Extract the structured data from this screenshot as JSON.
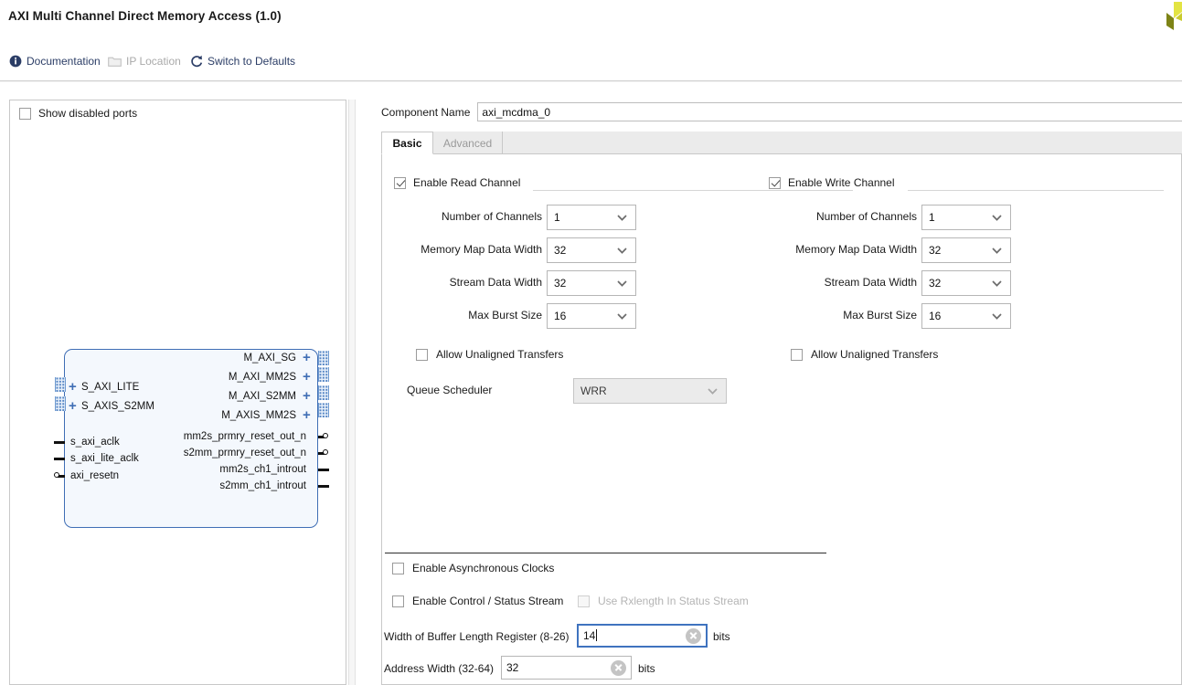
{
  "window": {
    "title": "AXI Multi Channel Direct Memory Access (1.0)",
    "logo_name": "amd-xilinx-logo"
  },
  "toolbar": {
    "links": [
      {
        "label": "Documentation",
        "icon": "info-icon",
        "enabled": true
      },
      {
        "label": "IP Location",
        "icon": "folder-icon",
        "enabled": false
      },
      {
        "label": "Switch to Defaults",
        "icon": "refresh-icon",
        "enabled": true
      }
    ]
  },
  "left_panel": {
    "show_disabled_ports": {
      "label": "Show disabled ports",
      "checked": false
    },
    "symbol": {
      "left_bus_ports": [
        "S_AXI_LITE",
        "S_AXIS_S2MM"
      ],
      "left_pins": [
        "s_axi_aclk",
        "s_axi_lite_aclk",
        "axi_resetn"
      ],
      "right_bus_ports": [
        "M_AXI_SG",
        "M_AXI_MM2S",
        "M_AXI_S2MM",
        "M_AXIS_MM2S"
      ],
      "right_pins": [
        "mm2s_prmry_reset_out_n",
        "s2mm_prmry_reset_out_n",
        "mm2s_ch1_introut",
        "s2mm_ch1_introut"
      ]
    }
  },
  "component": {
    "name_label": "Component Name",
    "name_value": "axi_mcdma_0"
  },
  "tabs": [
    {
      "label": "Basic",
      "active": true
    },
    {
      "label": "Advanced",
      "active": false
    }
  ],
  "read_channel": {
    "title": "Enable Read Channel",
    "checked": true,
    "fields": [
      {
        "label": "Number of Channels",
        "value": "1"
      },
      {
        "label": "Memory Map Data Width",
        "value": "32"
      },
      {
        "label": "Stream Data Width",
        "value": "32"
      },
      {
        "label": "Max Burst Size",
        "value": "16"
      }
    ],
    "allow_unaligned": {
      "label": "Allow Unaligned Transfers",
      "checked": false
    },
    "queue_scheduler": {
      "label": "Queue Scheduler",
      "value": "WRR",
      "enabled": false
    }
  },
  "write_channel": {
    "title": "Enable Write Channel",
    "checked": true,
    "fields": [
      {
        "label": "Number of Channels",
        "value": "1"
      },
      {
        "label": "Memory Map Data Width",
        "value": "32"
      },
      {
        "label": "Stream Data Width",
        "value": "32"
      },
      {
        "label": "Max Burst Size",
        "value": "16"
      }
    ],
    "allow_unaligned": {
      "label": "Allow Unaligned Transfers",
      "checked": false
    }
  },
  "common": {
    "async_clocks": {
      "label": "Enable Asynchronous Clocks",
      "checked": false
    },
    "control_stream": {
      "label": "Enable Control / Status Stream",
      "checked": false
    },
    "use_rxlength": {
      "label": "Use Rxlength In Status Stream",
      "checked": false,
      "enabled": false
    },
    "buffer_length": {
      "label": "Width of Buffer Length Register (8-26)",
      "value": "14",
      "unit": "bits"
    },
    "address_width": {
      "label": "Address Width (32-64)",
      "value": "32",
      "unit": "bits"
    }
  },
  "colors": {
    "accent": "#3f6eb5",
    "link": "#2b3d66",
    "focus_border": "#3f73bf",
    "symbol_fill": "#f4f8fd"
  }
}
